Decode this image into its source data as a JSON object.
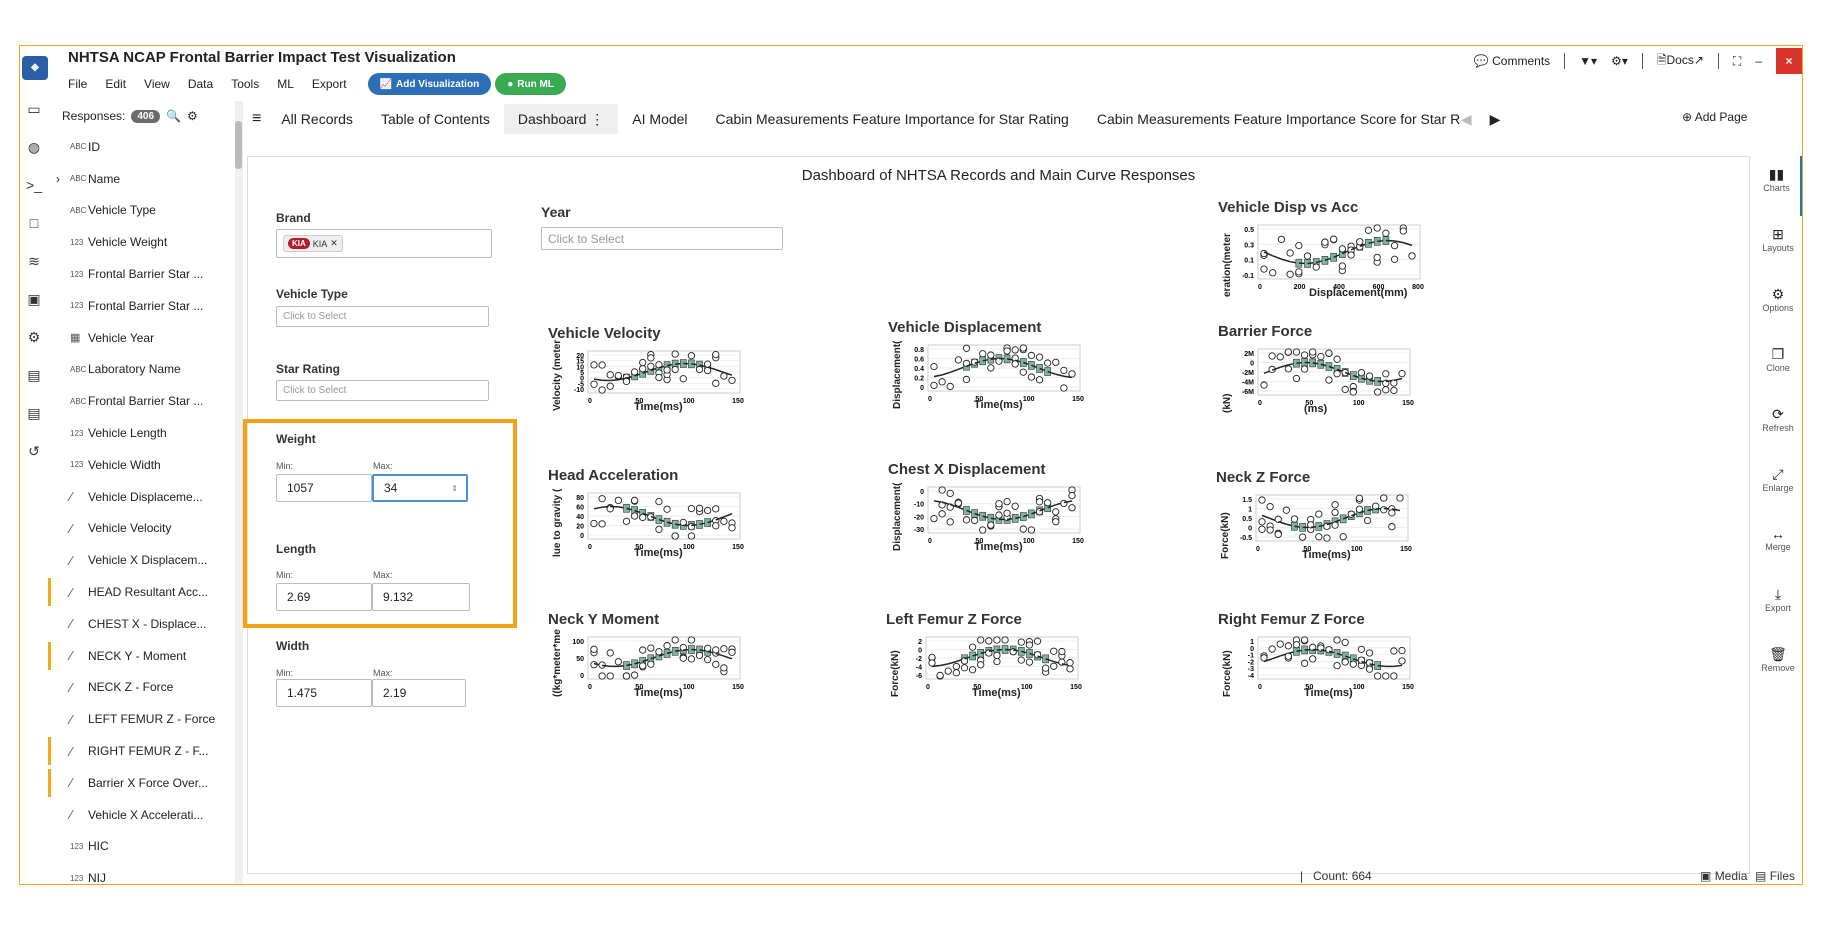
{
  "app": {
    "title": "NHTSA NCAP Frontal Barrier Impact Test Visualization",
    "menu": [
      "File",
      "Edit",
      "View",
      "Data",
      "Tools",
      "ML",
      "Export"
    ],
    "add_viz_label": "Add Visualization",
    "run_ml_label": "Run ML",
    "comments_label": "Comments",
    "docs_label": "Docs",
    "close_label": "×",
    "min_label": "–"
  },
  "sidebar": {
    "responses_label": "Responses:",
    "responses_count": "406",
    "fields": [
      {
        "type": "ABC",
        "label": "ID"
      },
      {
        "type": "ABC",
        "label": "Name"
      },
      {
        "type": "ABC",
        "label": "Vehicle Type"
      },
      {
        "type": "123",
        "label": "Vehicle Weight"
      },
      {
        "type": "123",
        "label": "Frontal Barrier Star ..."
      },
      {
        "type": "123",
        "label": "Frontal Barrier Star ..."
      },
      {
        "type": "cal",
        "label": "Vehicle Year"
      },
      {
        "type": "ABC",
        "label": "Laboratory Name"
      },
      {
        "type": "ABC",
        "label": "Frontal Barrier Star ..."
      },
      {
        "type": "123",
        "label": "Vehicle Length"
      },
      {
        "type": "123",
        "label": "Vehicle Width"
      },
      {
        "type": "curve",
        "label": "Vehicle Displaceme..."
      },
      {
        "type": "curve",
        "label": "Vehicle Velocity"
      },
      {
        "type": "curve",
        "label": "Vehicle X Displacem..."
      },
      {
        "type": "curve",
        "label": "HEAD Resultant Acc..."
      },
      {
        "type": "curve",
        "label": "CHEST X - Displace..."
      },
      {
        "type": "curve",
        "label": "NECK Y - Moment"
      },
      {
        "type": "curve",
        "label": "NECK Z - Force"
      },
      {
        "type": "curve",
        "label": "LEFT FEMUR Z - Force"
      },
      {
        "type": "curve",
        "label": "RIGHT FEMUR Z - F..."
      },
      {
        "type": "curve",
        "label": "Barrier X Force Over..."
      },
      {
        "type": "curve",
        "label": "Vehicle X Accelerati..."
      },
      {
        "type": "123",
        "label": "HIC"
      },
      {
        "type": "123",
        "label": "NIJ"
      }
    ]
  },
  "tabs": [
    {
      "label": "All Records"
    },
    {
      "label": "Table of Contents"
    },
    {
      "label": "Dashboard"
    },
    {
      "label": "AI Model"
    },
    {
      "label": "Cabin Measurements Feature Importance for Star Rating"
    },
    {
      "label": "Cabin Measurements Feature Importance Score for Star Ra"
    }
  ],
  "add_page_label": "Add Page",
  "dashboard": {
    "title": "Dashboard of NHTSA Records and Main Curve Responses",
    "filters": {
      "brand_label": "Brand",
      "brand_chip": "KIA",
      "brand_chip_text": "KIA",
      "vehicle_type_label": "Vehicle Type",
      "vehicle_type_placeholder": "Click to Select",
      "star_rating_label": "Star Rating",
      "star_rating_placeholder": "Click to Select",
      "year_label": "Year",
      "year_placeholder": "Click to Select",
      "weight_label": "Weight",
      "weight_min": "1057",
      "weight_max": "34",
      "length_label": "Length",
      "length_min": "2.69",
      "length_max": "9.132",
      "width_label": "Width",
      "width_min": "1.475",
      "width_max": "2.19",
      "min_label": "Min:",
      "max_label": "Max:"
    },
    "charts": [
      {
        "title": "Vehicle Disp vs Acc",
        "xlabel": "Displacement(mm)",
        "ylabel": "eration(meter",
        "xticks": [
          "0",
          "200",
          "400",
          "600",
          "800"
        ],
        "yticks": [
          "0.5",
          "0.3",
          "0.1",
          "-0.1"
        ]
      },
      {
        "title": "Vehicle Velocity",
        "xlabel": "Time(ms)",
        "ylabel": "Velocity (meter",
        "xticks": [
          "0",
          "50",
          "100",
          "150"
        ],
        "yticks": [
          "20",
          "15",
          "10",
          "5",
          "0",
          "-5",
          "-10"
        ]
      },
      {
        "title": "Vehicle Displacement",
        "xlabel": "Time(ms)",
        "ylabel": "Displacement(",
        "xticks": [
          "0",
          "50",
          "100",
          "150"
        ],
        "yticks": [
          "0.8",
          "0.6",
          "0.4",
          "0.2",
          "0"
        ]
      },
      {
        "title": "Barrier Force",
        "xlabel": "(ms)",
        "ylabel": "(kN)",
        "xticks": [
          "0",
          "50",
          "100",
          "150"
        ],
        "yticks": [
          "2M",
          "0",
          "-2M",
          "-4M",
          "-6M"
        ]
      },
      {
        "title": "Head Acceleration",
        "xlabel": "Time(ms)",
        "ylabel": "lue to gravity (",
        "xticks": [
          "0",
          "50",
          "100",
          "150"
        ],
        "yticks": [
          "80",
          "60",
          "40",
          "20",
          "0"
        ]
      },
      {
        "title": "Chest X Displacement",
        "xlabel": "Time(ms)",
        "ylabel": "Displacement(",
        "xticks": [
          "0",
          "50",
          "100",
          "150"
        ],
        "yticks": [
          "0",
          "-10",
          "-20",
          "-30"
        ]
      },
      {
        "title": "Neck Z Force",
        "xlabel": "Time(ms)",
        "ylabel": "Force(kN)",
        "xticks": [
          "0",
          "50",
          "100",
          "150"
        ],
        "yticks": [
          "1.5",
          "1",
          "0.5",
          "0",
          "-0.5"
        ]
      },
      {
        "title": "Neck Y Moment",
        "xlabel": "Time(ms)",
        "ylabel": "((kg*meter*me",
        "xticks": [
          "0",
          "50",
          "100",
          "150"
        ],
        "yticks": [
          "100",
          "50",
          "0"
        ]
      },
      {
        "title": "Left Femur Z Force",
        "xlabel": "Time(ms)",
        "ylabel": "Force(kN)",
        "xticks": [
          "0",
          "50",
          "100",
          "150"
        ],
        "yticks": [
          "2",
          "0",
          "-2",
          "-4",
          "-6"
        ]
      },
      {
        "title": "Right Femur Z Force",
        "xlabel": "Time(ms)",
        "ylabel": "Force(kN)",
        "xticks": [
          "0",
          "50",
          "100",
          "150"
        ],
        "yticks": [
          "1",
          "0",
          "-1",
          "-2",
          "-3",
          "-4"
        ]
      }
    ]
  },
  "right_rail": [
    {
      "icon": "charts-icon",
      "label": "Charts"
    },
    {
      "icon": "layouts-icon",
      "label": "Layouts"
    },
    {
      "icon": "options-icon",
      "label": "Options"
    },
    {
      "icon": "clone-icon",
      "label": "Clone"
    },
    {
      "icon": "refresh-icon",
      "label": "Refresh"
    },
    {
      "icon": "enlarge-icon",
      "label": "Enlarge"
    },
    {
      "icon": "merge-icon",
      "label": "Merge"
    },
    {
      "icon": "export-icon",
      "label": "Export"
    },
    {
      "icon": "remove-icon",
      "label": "Remove"
    }
  ],
  "status": {
    "count_label": "Count: 664",
    "media_label": "Media",
    "files_label": "Files"
  },
  "colors": {
    "accent": "#2d6fb7",
    "highlight": "#f5a316",
    "run_ml": "#3aaa55",
    "close": "#d9342b",
    "box_fill": "#7fb3a3"
  }
}
